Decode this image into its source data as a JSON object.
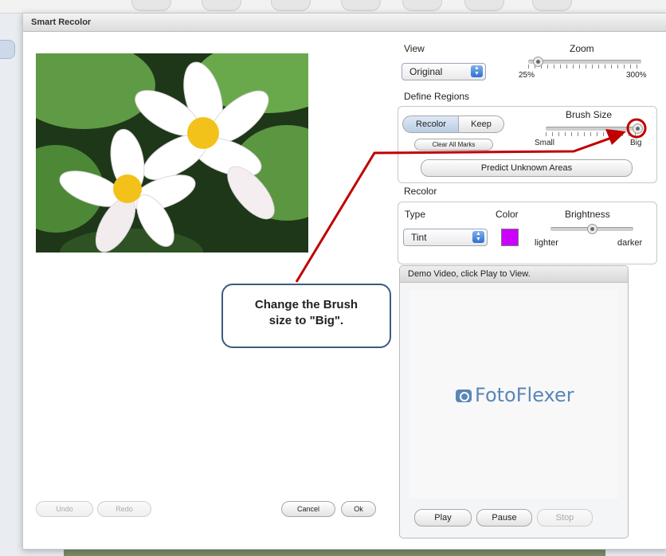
{
  "dialog": {
    "title": "Smart Recolor"
  },
  "photo": {
    "description_icon": "water-lily-photo"
  },
  "view": {
    "label": "View",
    "selected": "Original",
    "zoom_label": "Zoom",
    "zoom_min": "25%",
    "zoom_max": "300%",
    "zoom_level": 0.1
  },
  "define_regions": {
    "label": "Define Regions",
    "recolor_label": "Recolor",
    "keep_label": "Keep",
    "clear_label": "Clear All Marks",
    "brush_label": "Brush Size",
    "brush_small": "Small",
    "brush_big": "Big",
    "brush_level": 1.0,
    "predict_label": "Predict Unknown Areas"
  },
  "recolor": {
    "label": "Recolor",
    "type_label": "Type",
    "type_selected": "Tint",
    "color_label": "Color",
    "color_value": "#cc00ff",
    "brightness_label": "Brightness",
    "lighter": "lighter",
    "darker": "darker",
    "brightness_level": 0.5
  },
  "demo": {
    "header": "Demo Video, click Play to View.",
    "logo": "FotoFlexer",
    "play": "Play",
    "pause": "Pause",
    "stop": "Stop"
  },
  "actions": {
    "undo": "Undo",
    "redo": "Redo",
    "cancel": "Cancel",
    "ok": "Ok"
  },
  "callout": {
    "line1": "Change the Brush",
    "line2": "size to \"Big\"."
  },
  "colors": {
    "annotation": "#c00000",
    "callout_border": "#3c5a80"
  }
}
